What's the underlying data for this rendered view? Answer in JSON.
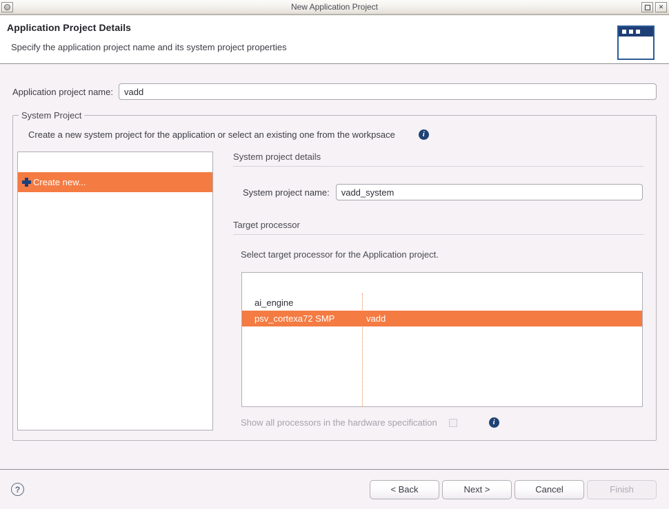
{
  "window": {
    "title": "New Application Project",
    "system_menu_icon": "system-menu-icon",
    "maximize_icon": "maximize-icon",
    "close_label": "✕"
  },
  "header": {
    "title": "Application Project Details",
    "subtitle": "Specify the application project name and its system project properties",
    "icon": "new-project-wizard-icon"
  },
  "form": {
    "app_project_name_label": "Application project name:",
    "app_project_name_value": "vadd",
    "app_project_name_placeholder": "Application project name"
  },
  "system_project_group": {
    "legend": "System Project",
    "description": "Create a new system project for the application or select an existing one from the workpsace",
    "info_icon": "info-icon",
    "info_glyph": "i",
    "list": {
      "items": [
        {
          "label": "Create new...",
          "selected": true,
          "icon": "plus-icon"
        }
      ]
    },
    "details": {
      "section_title": "System project details",
      "system_project_name_label": "System project name:",
      "system_project_name_value": "vadd_system",
      "system_project_name_placeholder": "System project name"
    },
    "target_processor": {
      "section_title": "Target processor",
      "instruction": "Select target processor for the Application project.",
      "columns": [
        "",
        ""
      ],
      "rows": [
        {
          "name": "ai_engine",
          "application": "",
          "selected": false
        },
        {
          "name": "psv_cortexa72 SMP",
          "application": "vadd",
          "selected": true
        }
      ],
      "show_all_label": "Show all processors in the hardware specification",
      "show_all_checked": false,
      "show_all_enabled": false,
      "info_icon": "info-icon",
      "info_glyph": "i"
    }
  },
  "footer": {
    "help_label": "?",
    "back_label": "< Back",
    "next_label": "Next >",
    "cancel_label": "Cancel",
    "finish_label": "Finish",
    "finish_enabled": false
  }
}
